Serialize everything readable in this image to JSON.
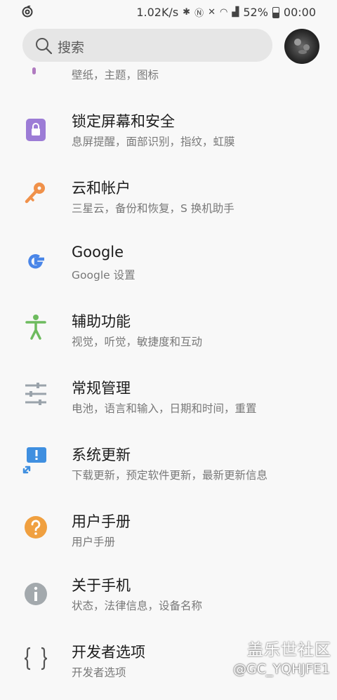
{
  "status_bar": {
    "speed": "1.02K/s",
    "battery_percent": "52%",
    "time": "00:00"
  },
  "search": {
    "placeholder": "搜索"
  },
  "partial_item": {
    "subtitle": "壁纸，主题，图标"
  },
  "items": [
    {
      "title": "锁定屏幕和安全",
      "subtitle": "息屏提醒，面部识别，指纹，虹膜",
      "icon": "lock-icon",
      "color": "#9c7cd6"
    },
    {
      "title": "云和帐户",
      "subtitle": "三星云，备份和恢复，S 换机助手",
      "icon": "key-icon",
      "color": "#f0914a"
    },
    {
      "title": "Google",
      "subtitle": "Google 设置",
      "icon": "google-g-icon",
      "color": "#4a86e8"
    },
    {
      "title": "辅助功能",
      "subtitle": "视觉，听觉，敏捷度和互动",
      "icon": "accessibility-icon",
      "color": "#6dbb5e"
    },
    {
      "title": "常规管理",
      "subtitle": "电池，语言和输入，日期和时间，重置",
      "icon": "sliders-icon",
      "color": "#9aa3ab"
    },
    {
      "title": "系统更新",
      "subtitle": "下载更新，预定软件更新，最新更新信息",
      "icon": "system-update-icon",
      "color": "#3f8fe0"
    },
    {
      "title": "用户手册",
      "subtitle": "用户手册",
      "icon": "question-icon",
      "color": "#f0a040"
    },
    {
      "title": "关于手机",
      "subtitle": "状态，法律信息，设备名称",
      "icon": "info-icon",
      "color": "#a3a9ad"
    },
    {
      "title": "开发者选项",
      "subtitle": "开发者选项",
      "icon": "braces-icon",
      "color": "#555555"
    }
  ],
  "watermark": {
    "logo": "盖乐世社区",
    "user": "@GC_YQHJFE1"
  }
}
